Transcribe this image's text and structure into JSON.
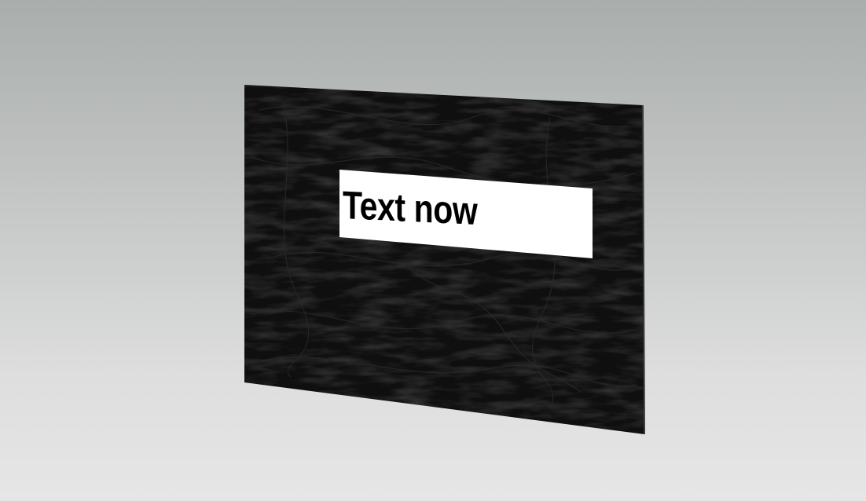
{
  "sign": {
    "text": "Text now",
    "board_color": "#111111",
    "label_color": "#ffffff",
    "text_color": "#000000"
  }
}
